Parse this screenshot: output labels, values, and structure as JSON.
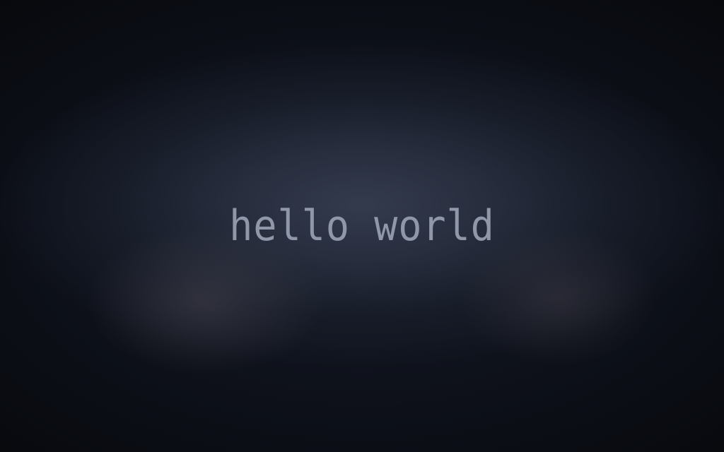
{
  "wallpaper": {
    "text": "hello world",
    "text_color": "#8f97a8",
    "background_colors": [
      "#05070b",
      "#343b4d"
    ]
  }
}
